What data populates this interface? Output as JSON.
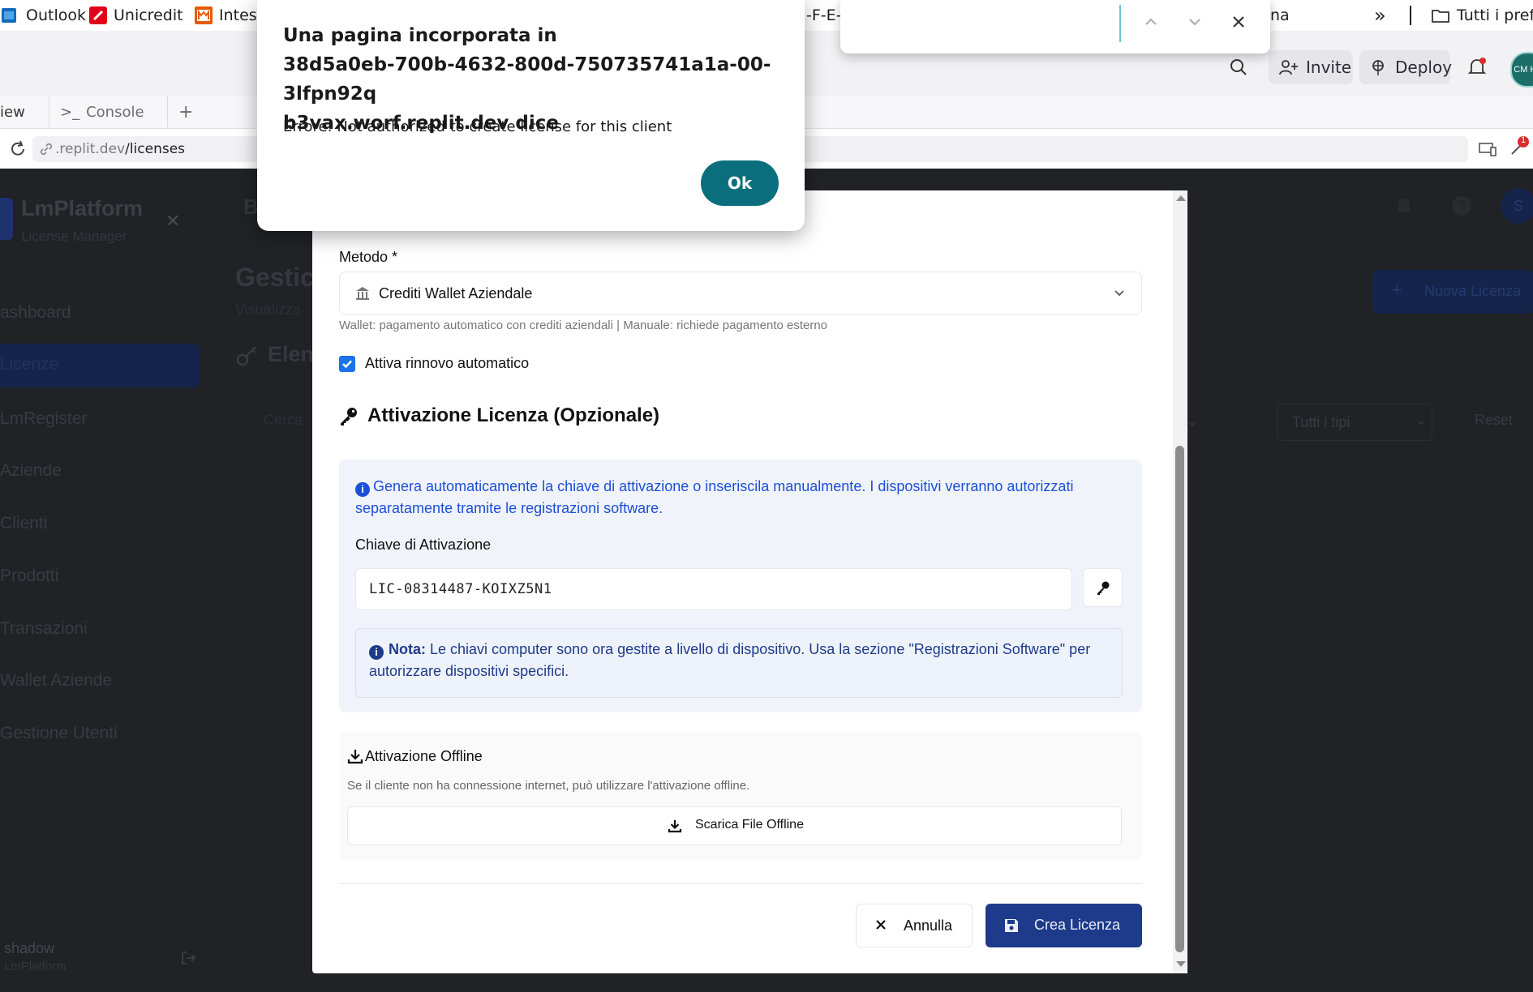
{
  "bookmarks": [
    {
      "label": "Outlook",
      "color": "#0f6cbd"
    },
    {
      "label": "Unicredit",
      "color": "#e2001a"
    },
    {
      "label": "Intesa",
      "color": "#e65a00"
    },
    {
      "label": "-F-E-",
      "color": "#333333"
    },
    {
      "label": "na",
      "color": "#333333"
    }
  ],
  "bookmarks_overflow": "»",
  "bookmarks_folder": "Tutti i prefe",
  "find_bar": {
    "query": ""
  },
  "topbar": {
    "invite_label": "Invite",
    "deploy_label": "Deploy",
    "avatar_text": "CM HK"
  },
  "panel_tabs": {
    "preview_label": "iew",
    "console_label": "Console",
    "add_label": "+"
  },
  "url": {
    "domain": ".replit.dev",
    "path": "/licenses"
  },
  "notifications_badge": "1",
  "app": {
    "brand": "LmPlatform",
    "brand_sub": "License Manager",
    "sidebar": [
      "ashboard",
      "Licenze",
      "LmRegister",
      "Aziende",
      "Clienti",
      "Prodotti",
      "Transazioni",
      "Wallet Aziende",
      "Gestione Utenti"
    ],
    "user_name": "shadow",
    "user_org": "LmPlatform",
    "page_title": "Gestic",
    "page_subtitle": "Visualizza",
    "section_title": "Elen",
    "header_letter": "B",
    "new_license_button": "Nuova Licenza",
    "search_placeholder": "Cerca",
    "filter_types": "Tutti i tipi",
    "reset_label": "Reset",
    "avatar_letter": "S"
  },
  "modal": {
    "method_label": "Metodo *",
    "method_value": "Crediti Wallet Aziendale",
    "method_help": "Wallet: pagamento automatico con crediti aziendali | Manuale: richiede pagamento esterno",
    "auto_renew_label": "Attiva rinnovo automatico",
    "auto_renew_checked": true,
    "activation_title": "Attivazione Licenza (Opzionale)",
    "activation_info": "Genera automaticamente la chiave di attivazione o inseriscila manualmente. I dispositivi verranno autorizzati separatamente tramite le registrazioni software.",
    "key_label": "Chiave di Attivazione",
    "key_value": "LIC-08314487-KOIXZ5N1",
    "note_bold": "Nota:",
    "note_text": "Le chiavi computer sono ora gestite a livello di dispositivo. Usa la sezione \"Registrazioni Software\" per autorizzare dispositivi specifici.",
    "offline_title": "Attivazione Offline",
    "offline_desc": "Se il cliente non ha connessione internet, può utilizzare l'attivazione offline.",
    "offline_button": "Scarica File Offline",
    "cancel_button": "Annulla",
    "create_button": "Crea Licenza"
  },
  "dialog": {
    "title_line1": "Una pagina incorporata in",
    "title_line2": "38d5a0eb-700b-4632-800d-750735741a1a-00-3lfpn92q",
    "title_line3": "b3vax.worf.replit.dev dice",
    "message": "Errore: Not authorized to create license for this client",
    "ok_button": "Ok"
  },
  "colors": {
    "accent_primary": "#1e3a8a",
    "ok_button": "#0b6e7d",
    "info_blue": "#1d4ed8",
    "dim_overlay": "#212226"
  }
}
